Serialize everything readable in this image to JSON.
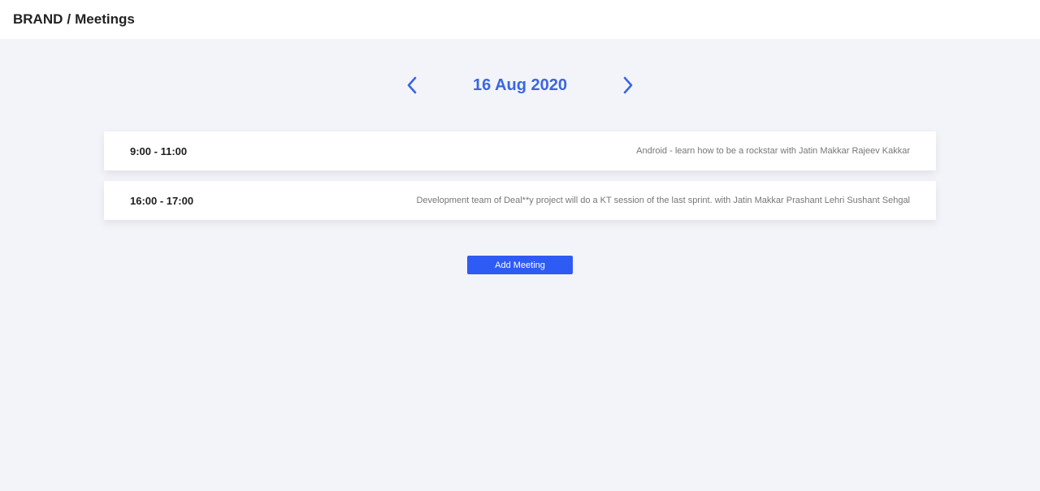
{
  "header": {
    "brand": "BRAND",
    "separator": "/",
    "page": "Meetings"
  },
  "date_nav": {
    "date": "16 Aug 2020",
    "prev_icon": "chevron-left-icon",
    "next_icon": "chevron-right-icon",
    "accent_color": "#3a66e0"
  },
  "meetings": [
    {
      "time": "9:00 - 11:00",
      "description": "Android - learn how to be a rockstar with Jatin Makkar Rajeev Kakkar"
    },
    {
      "time": "16:00 - 17:00",
      "description": "Development team of Deal**y project will do a KT session of the last sprint. with Jatin Makkar Prashant Lehri Sushant Sehgal"
    }
  ],
  "actions": {
    "add_label": "Add Meeting",
    "button_color": "#2f5bf5"
  }
}
